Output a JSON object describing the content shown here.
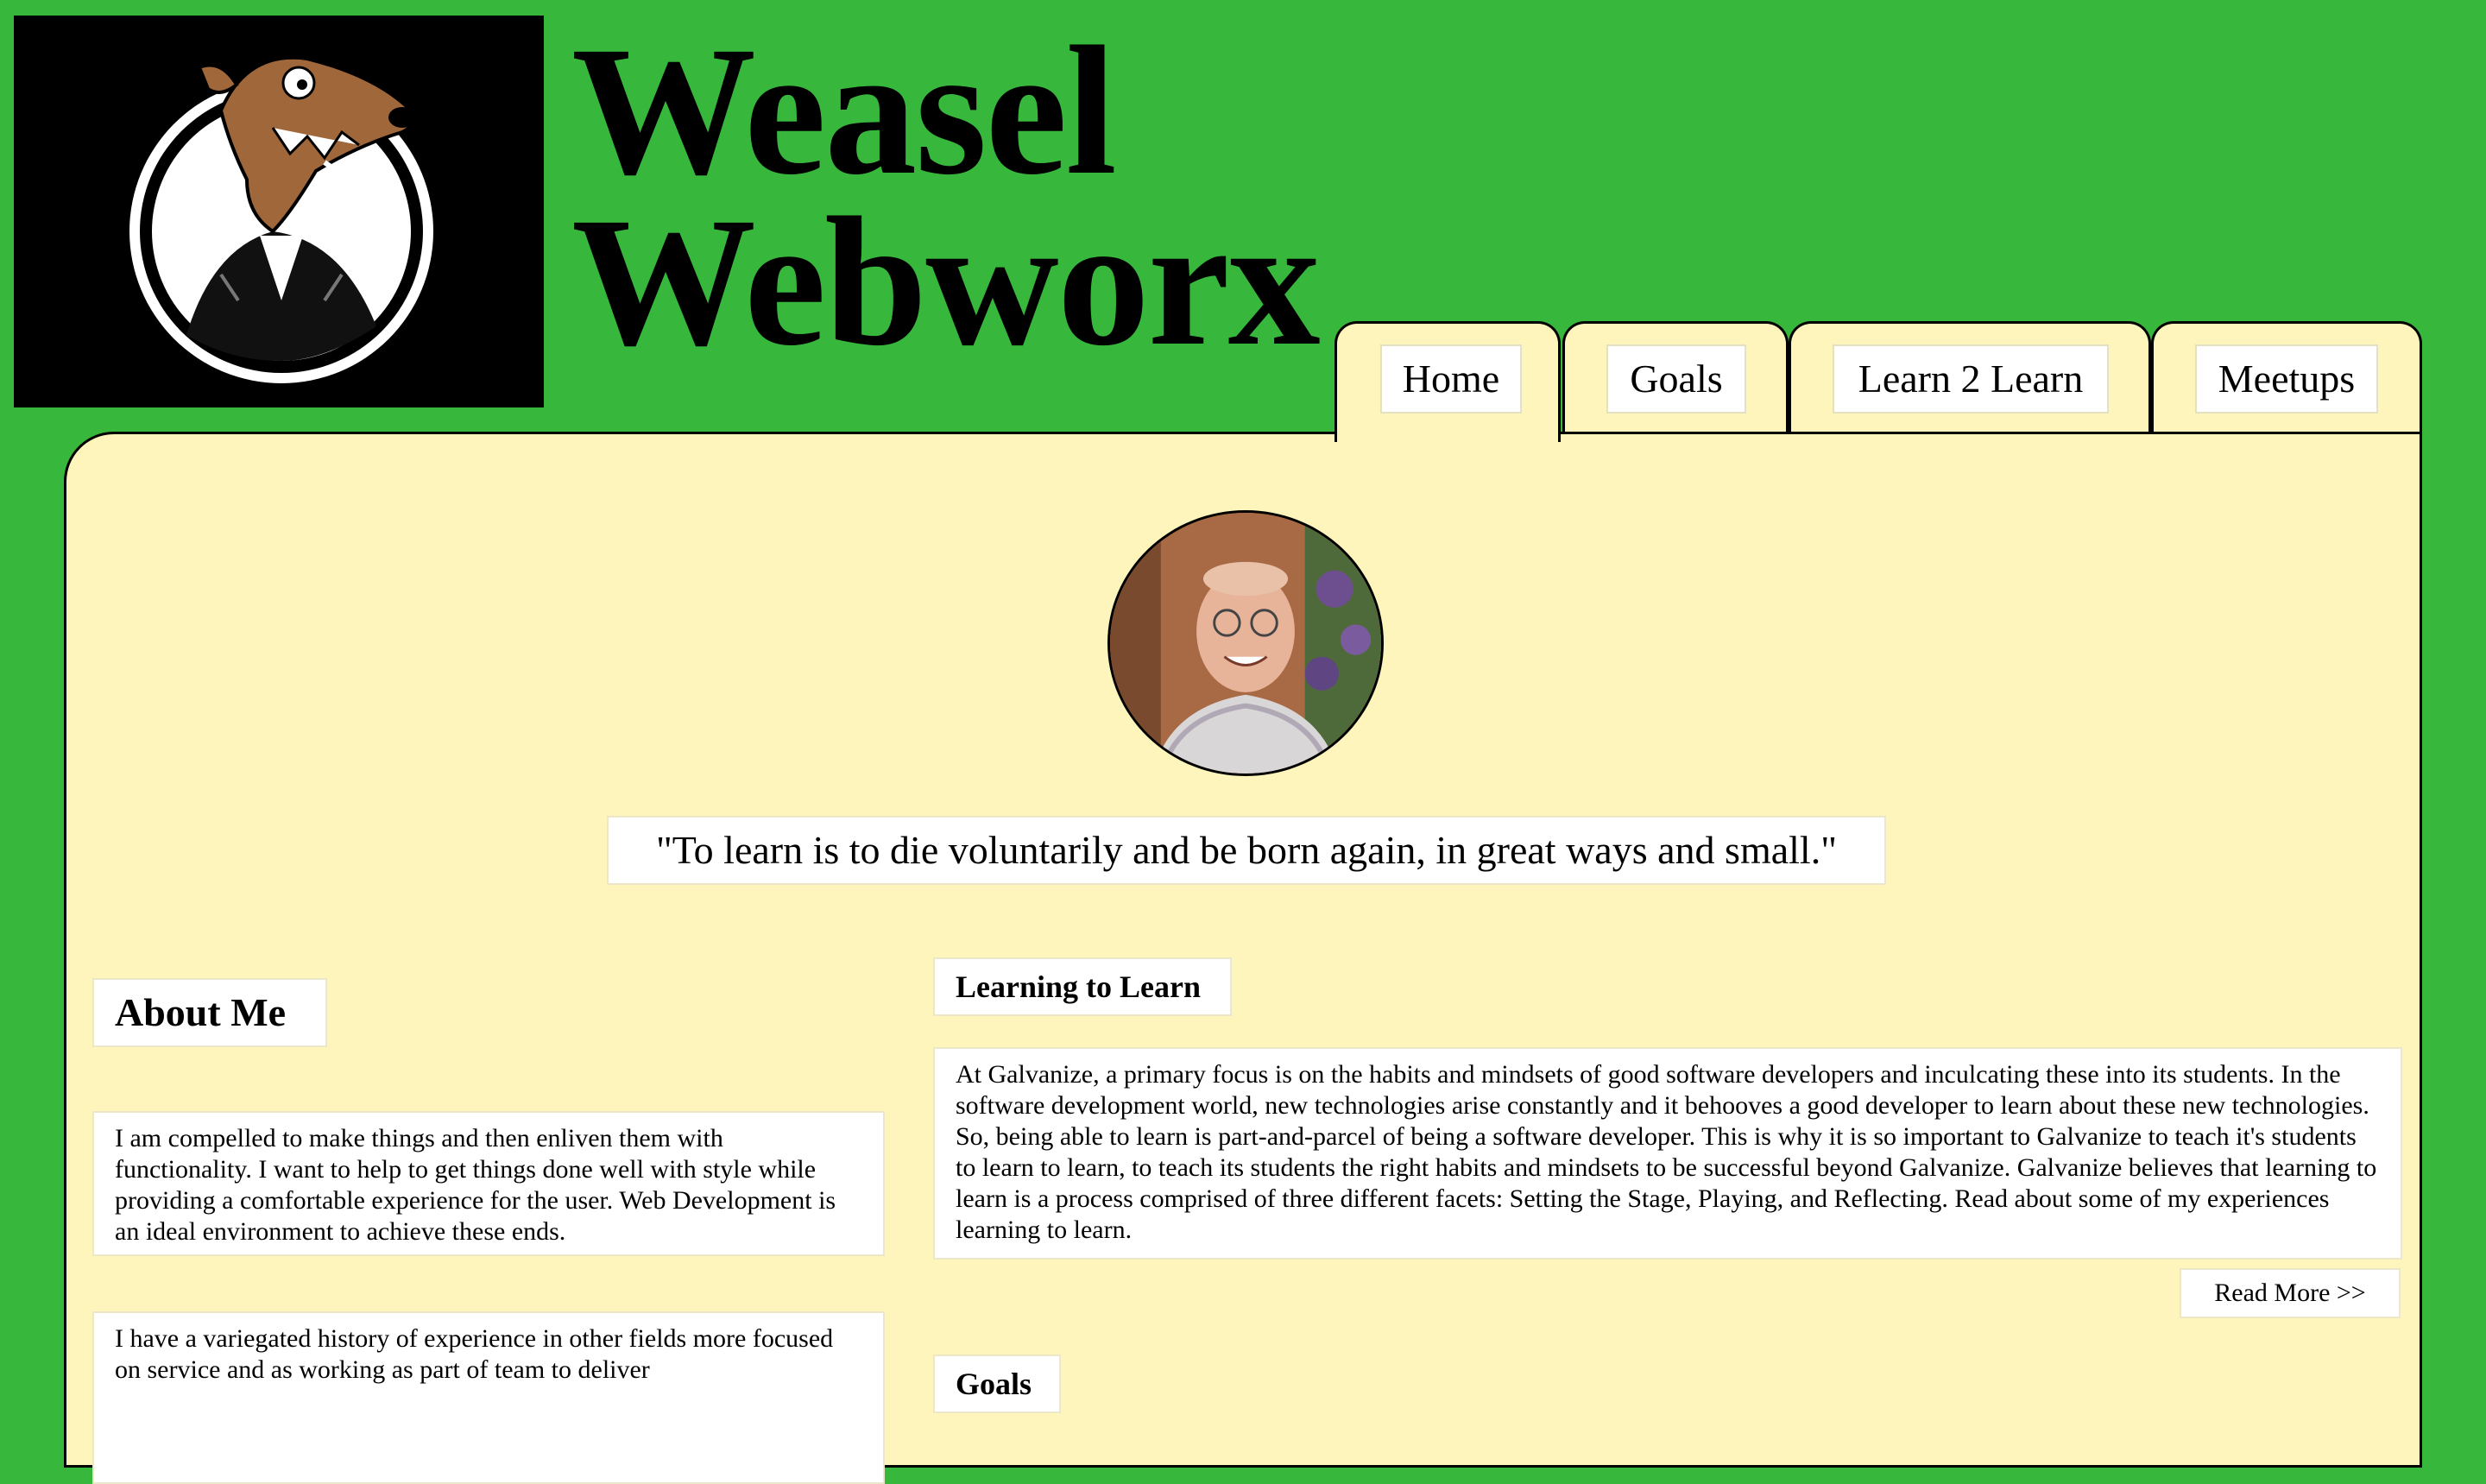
{
  "site": {
    "title_line1": "Weasel",
    "title_line2": "Webworx",
    "logo_icon": "weasel-logo-icon"
  },
  "nav": {
    "tabs": [
      {
        "label": "Home",
        "active": true
      },
      {
        "label": "Goals",
        "active": false
      },
      {
        "label": "Learn 2 Learn",
        "active": false
      },
      {
        "label": "Meetups",
        "active": false
      }
    ]
  },
  "hero": {
    "avatar_icon": "profile-photo",
    "quote": "\"To learn is to die voluntarily and be born again, in great ways and small.\""
  },
  "about": {
    "heading": "About Me",
    "paragraph1": "I am compelled to make things and then enliven them with functionality. I want to help to get things done well with style while providing a comfortable experience for the user. Web Development is an ideal environment to achieve these ends.",
    "paragraph2": "I have a variegated history of experience in other fields more focused on service and as working as part of team to deliver"
  },
  "learning": {
    "heading": "Learning to Learn",
    "paragraph": "At Galvanize, a primary focus is on the habits and mindsets of good software developers and inculcating these into its students. In the software development world, new technologies arise constantly and it behooves a good developer to learn about these new technologies. So, being able to learn is part-and-parcel of being a software developer. This is why it is so important to Galvanize to teach it's students to learn to learn, to teach its students the right habits and mindsets to be successful beyond Galvanize. Galvanize believes that learning to learn is a process comprised of three different facets: Setting the Stage, Playing, and Reflecting. Read about some of my experiences learning to learn.",
    "read_more": "Read More >>"
  },
  "goals": {
    "heading": "Goals"
  },
  "colors": {
    "background": "#37b73c",
    "panel": "#fdf5bb",
    "card": "#ffffff"
  }
}
